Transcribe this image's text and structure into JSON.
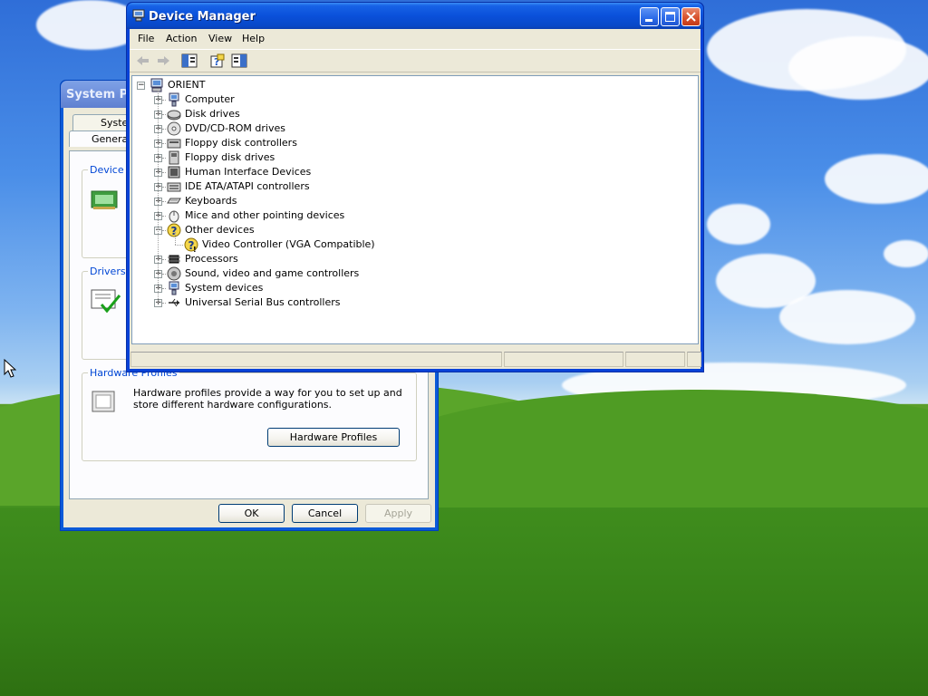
{
  "device_manager": {
    "title": "Device Manager",
    "menu": [
      "File",
      "Action",
      "View",
      "Help"
    ],
    "tree": {
      "root": "ORIENT",
      "items": [
        {
          "label": "Computer",
          "icon": "computer-icon"
        },
        {
          "label": "Disk drives",
          "icon": "disk-drive-icon"
        },
        {
          "label": "DVD/CD-ROM drives",
          "icon": "cdrom-icon"
        },
        {
          "label": "Floppy disk controllers",
          "icon": "floppy-controller-icon"
        },
        {
          "label": "Floppy disk drives",
          "icon": "floppy-drive-icon"
        },
        {
          "label": "Human Interface Devices",
          "icon": "hid-icon"
        },
        {
          "label": "IDE ATA/ATAPI controllers",
          "icon": "ide-controller-icon"
        },
        {
          "label": "Keyboards",
          "icon": "keyboard-icon"
        },
        {
          "label": "Mice and other pointing devices",
          "icon": "mouse-icon"
        },
        {
          "label": "Other devices",
          "icon": "unknown-device-icon",
          "expanded": true,
          "children": [
            {
              "label": "Video Controller (VGA Compatible)",
              "icon": "warning-device-icon"
            }
          ]
        },
        {
          "label": "Processors",
          "icon": "processor-icon"
        },
        {
          "label": "Sound, video and game controllers",
          "icon": "sound-icon"
        },
        {
          "label": "System devices",
          "icon": "system-device-icon"
        },
        {
          "label": "Universal Serial Bus controllers",
          "icon": "usb-icon"
        }
      ]
    }
  },
  "system_properties": {
    "title": "System Pro",
    "tabs": [
      "System",
      "General"
    ],
    "groups": {
      "device_manager": "Device M",
      "drivers": "Drivers",
      "hardware_profiles": "Hardware Profiles"
    },
    "hardware_profiles_text": "Hardware profiles provide a way for you to set up and store different hardware configurations.",
    "hardware_profiles_button": "Hardware Profiles",
    "ok": "OK",
    "cancel": "Cancel",
    "apply": "Apply"
  }
}
